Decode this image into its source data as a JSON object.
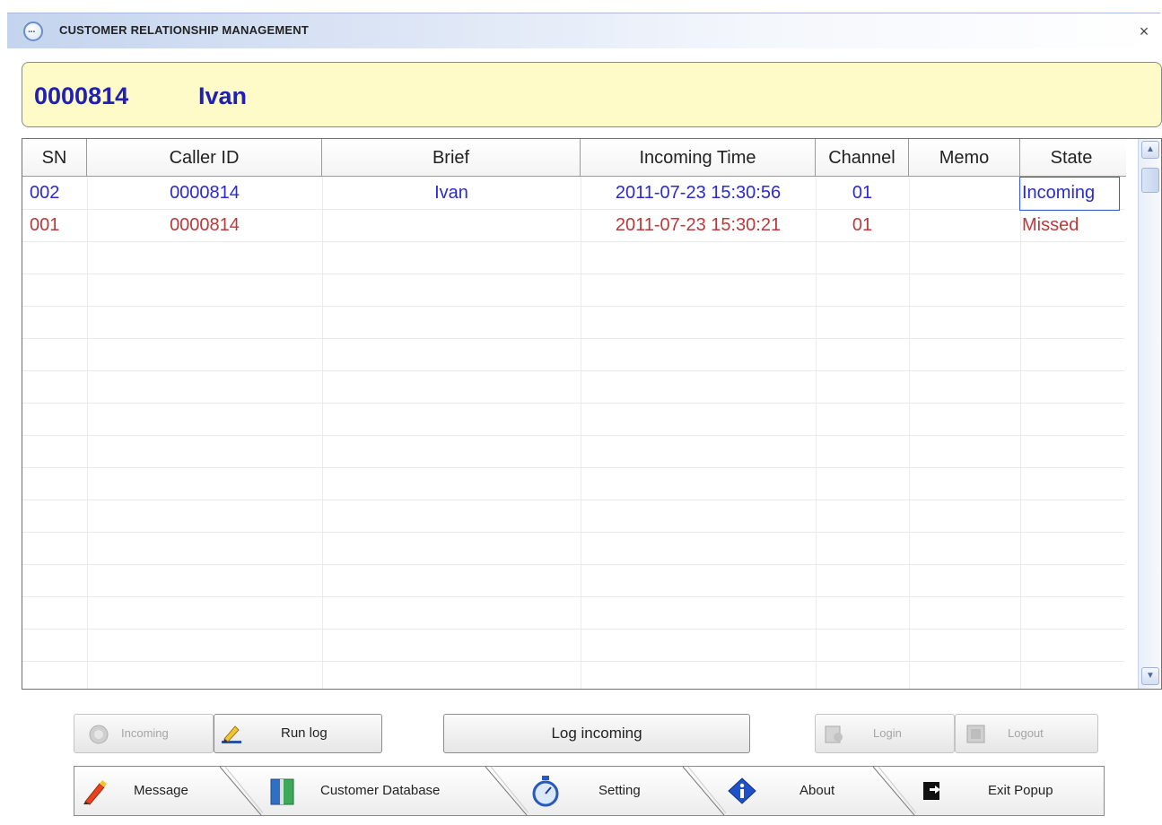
{
  "window": {
    "title": "CUSTOMER RELATIONSHIP MANAGEMENT",
    "close_glyph": "×"
  },
  "caller": {
    "number": "0000814",
    "name": "Ivan"
  },
  "table": {
    "columns": [
      "SN",
      "Caller ID",
      "Brief",
      "Incoming Time",
      "Channel",
      "Memo",
      "State"
    ],
    "rows": [
      {
        "sn": "002",
        "caller_id": "0000814",
        "brief": "Ivan",
        "time": "2011-07-23 15:30:56",
        "channel": "01",
        "memo": "",
        "state": "Incoming",
        "color": "#2a2ad0"
      },
      {
        "sn": "001",
        "caller_id": "0000814",
        "brief": "",
        "time": "2011-07-23 15:30:21",
        "channel": "01",
        "memo": "",
        "state": "Missed",
        "color": "#b83a3a"
      }
    ]
  },
  "buttons": {
    "incoming": "Incoming",
    "run_log": "Run log",
    "log_incoming": "Log incoming",
    "login": "Login",
    "logout": "Logout"
  },
  "toolbar": {
    "message": "Message",
    "customer_database": "Customer Database",
    "setting": "Setting",
    "about": "About",
    "exit_popup": "Exit Popup"
  },
  "icons": {
    "title": "chat-bubble-icon",
    "incoming": "phone-icon",
    "run_log": "pencil-log-icon",
    "login": "login-icon",
    "logout": "logout-icon",
    "message": "pencil-icon",
    "customer_database": "book-icon",
    "setting": "stopwatch-icon",
    "about": "info-icon",
    "exit_popup": "exit-door-icon"
  },
  "colors": {
    "accent_blue": "#2020b8",
    "banner_bg": "#fefbc8",
    "incoming_text": "#2a2ad0",
    "missed_text": "#b83a3a"
  }
}
